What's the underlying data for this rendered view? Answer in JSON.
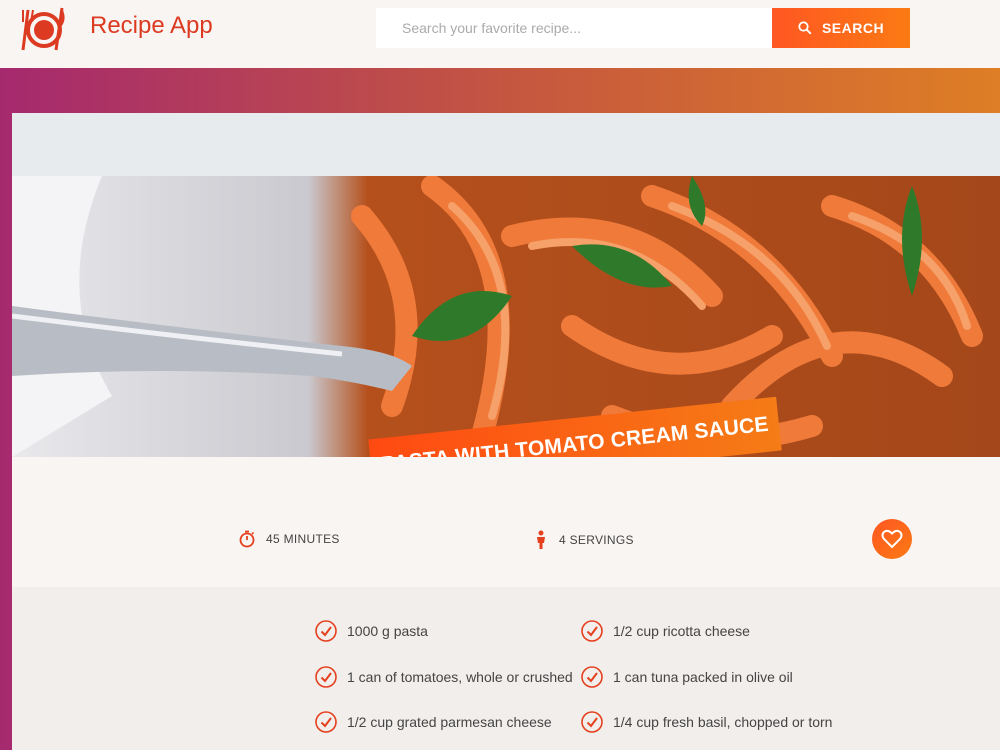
{
  "header": {
    "brand": "Recipe App",
    "search_placeholder": "Search your favorite recipe...",
    "search_button": "SEARCH"
  },
  "recipe": {
    "title": "PASTA WITH TOMATO CREAM SAUCE",
    "time": "45 MINUTES",
    "servings": "4 SERVINGS"
  },
  "ingredients": [
    "1000 g pasta",
    "1/2 cup ricotta cheese",
    "1 can of tomatoes, whole or crushed",
    "1 can tuna packed in olive oil",
    "1/2 cup grated parmesan cheese",
    "1/4 cup fresh basil, chopped or torn"
  ],
  "colors": {
    "brand": "#dc3a21",
    "accent_start": "#ff5722",
    "accent_end": "#fb7a14",
    "frame_left": "#a5296e",
    "frame_right": "#de7e25"
  }
}
